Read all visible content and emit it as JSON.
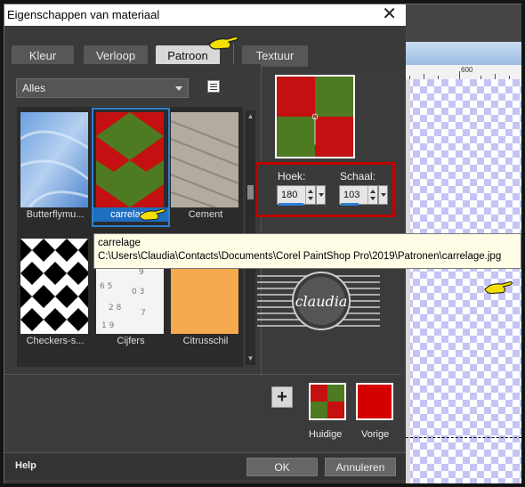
{
  "dialog": {
    "title": "Eigenschappen van materiaal",
    "close_glyph": "✕"
  },
  "tabs": [
    {
      "label": "Kleur",
      "active": false
    },
    {
      "label": "Verloop",
      "active": false
    },
    {
      "label": "Patroon",
      "active": true
    },
    {
      "label": "Textuur",
      "active": false
    }
  ],
  "category_select": {
    "value": "Alles"
  },
  "patterns": [
    {
      "label": "Butterflymu..."
    },
    {
      "label": "carrelage",
      "selected": true
    },
    {
      "label": "Cement"
    },
    {
      "label": "Checkers-s..."
    },
    {
      "label": "Cijfers"
    },
    {
      "label": "Citrusschil"
    }
  ],
  "tooltip": {
    "name": "carrelage",
    "path": "C:\\Users\\Claudia\\Contacts\\Documents\\Corel PaintShop Pro\\2019\\Patronen\\carrelage.jpg"
  },
  "angle": {
    "label": "Hoek:",
    "value": "180"
  },
  "scale": {
    "label": "Schaal:",
    "value": "103"
  },
  "logo": {
    "text": "claudia"
  },
  "swatches": {
    "current_label": "Huidige",
    "previous_label": "Vorige",
    "previous_color": "#d40000"
  },
  "buttons": {
    "help": "Help",
    "ok": "OK",
    "cancel": "Annuleren",
    "add": "+"
  },
  "ruler": {
    "mark": "600"
  },
  "colors": {
    "accent": "#2f7fd0",
    "highlight_box": "#c00000",
    "tile_red": "#c41010",
    "tile_green": "#4e7a22"
  }
}
